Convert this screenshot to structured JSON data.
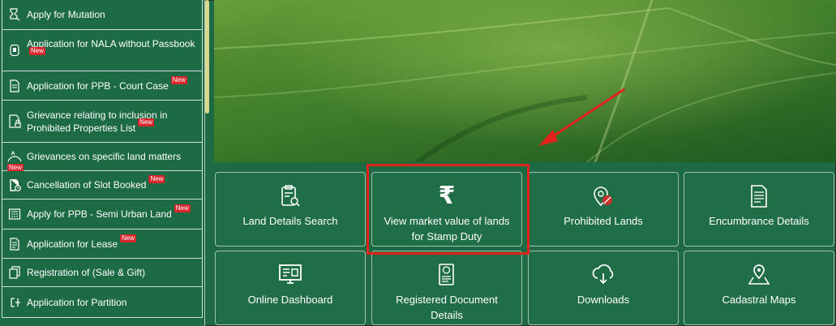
{
  "sidebar": {
    "items": [
      {
        "label": "Apply for Mutation",
        "icon": "hourglass-document-icon",
        "new": false
      },
      {
        "label": "Application for NALA without Passbook",
        "icon": "document-badge-icon",
        "new": true
      },
      {
        "label": "Application for PPB - Court Case",
        "icon": "document-icon",
        "new": true
      },
      {
        "label": "Grievance relating to inclusion in Prohibited Properties List",
        "icon": "lock-document-icon",
        "new": true
      },
      {
        "label": "Grievances on specific land matters",
        "icon": "land-icon",
        "new": true
      },
      {
        "label": "Cancellation of Slot Booked",
        "icon": "document-clock-icon",
        "new": true
      },
      {
        "label": "Apply for PPB - Semi Urban Land",
        "icon": "calculator-icon",
        "new": true
      },
      {
        "label": "Application for Lease",
        "icon": "document-list-icon",
        "new": true
      },
      {
        "label": "Registration of (Sale & Gift)",
        "icon": "copy-documents-icon",
        "new": false
      },
      {
        "label": "Application for Partition",
        "icon": "partition-icon",
        "new": false
      }
    ],
    "new_badge": "New"
  },
  "tiles": [
    {
      "label": "Land Details Search",
      "icon": "clipboard-search-icon"
    },
    {
      "label": "View market value of lands for Stamp Duty",
      "icon": "rupee-icon"
    },
    {
      "label": "Prohibited Lands",
      "icon": "location-prohibited-icon"
    },
    {
      "label": "Encumbrance Details",
      "icon": "document-lines-icon"
    },
    {
      "label": "Online Dashboard",
      "icon": "monitor-icon"
    },
    {
      "label": "Registered Document Details",
      "icon": "registered-document-icon"
    },
    {
      "label": "Downloads",
      "icon": "cloud-download-icon"
    },
    {
      "label": "Cadastral Maps",
      "icon": "map-pin-icon"
    }
  ],
  "annotation": {
    "highlight_color": "#e2221c",
    "arrow_color": "#e2221c"
  },
  "colors": {
    "primary_green": "#1f6e47",
    "badge_red": "#d9262c"
  }
}
